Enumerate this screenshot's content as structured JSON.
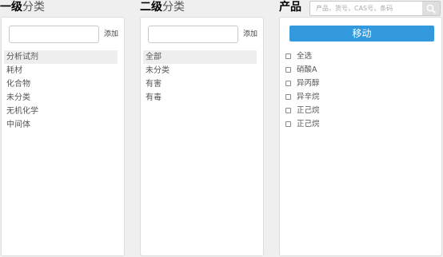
{
  "level1": {
    "title_bold": "一级",
    "title_rest": "分类",
    "add_label": "添加",
    "items": [
      "分析试剂",
      "耗材",
      "化合物",
      "未分类",
      "无机化学",
      "中间体"
    ]
  },
  "level2": {
    "title_bold": "二级",
    "title_rest": "分类",
    "add_label": "添加",
    "items": [
      "全部",
      "未分类",
      "有害",
      "有毒"
    ]
  },
  "product": {
    "title": "产品",
    "search_placeholder": "产品，货号，CAS号，条码",
    "move_label": "移动",
    "items": [
      "全选",
      "硝酸A",
      "异丙醇",
      "异辛烷",
      "正己烷",
      "正己烷"
    ]
  },
  "colors": {
    "accent": "#3399dd",
    "selected_bg": "#eeeeee"
  },
  "icons": {
    "search": "search-icon"
  }
}
